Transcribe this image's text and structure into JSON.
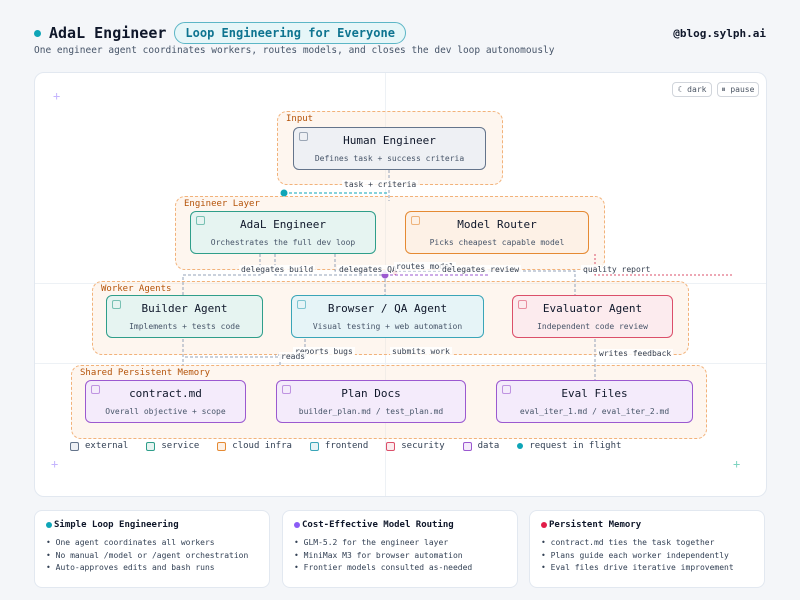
{
  "header": {
    "title": "AdaL Engineer",
    "pill": "Loop Engineering for Everyone",
    "handle": "@blog.sylph.ai",
    "subtitle": "One engineer agent coordinates workers, routes models, and closes the dev loop autonomously"
  },
  "toolbar": {
    "dark_label": "☾ dark",
    "pause_label": "⏸ pause"
  },
  "groups": {
    "input": "Input",
    "engineer": "Engineer Layer",
    "workers": "Worker Agents",
    "memory": "Shared Persistent Memory"
  },
  "nodes": {
    "human": {
      "title": "Human Engineer",
      "sub": "Defines task + success criteria"
    },
    "adal": {
      "title": "AdaL Engineer",
      "sub": "Orchestrates the full dev loop"
    },
    "router": {
      "title": "Model Router",
      "sub": "Picks cheapest capable model"
    },
    "builder": {
      "title": "Builder Agent",
      "sub": "Implements + tests code"
    },
    "browser": {
      "title": "Browser / QA Agent",
      "sub": "Visual testing + web automation"
    },
    "evaluator": {
      "title": "Evaluator Agent",
      "sub": "Independent code review"
    },
    "contract": {
      "title": "contract.md",
      "sub": "Overall objective + scope"
    },
    "plan": {
      "title": "Plan Docs",
      "sub": "builder_plan.md / test_plan.md"
    },
    "eval": {
      "title": "Eval Files",
      "sub": "eval_iter_1.md / eval_iter_2.md"
    }
  },
  "edges": {
    "task": "task + criteria",
    "delegates_build": "delegates build",
    "delegates_qa": "delegates QA",
    "routes_model": "routes model",
    "delegates_review": "delegates review",
    "quality_report": "quality report",
    "reports_bugs": "reports bugs",
    "submits_work": "submits work",
    "writes_feedback": "writes feedback",
    "reads": "reads"
  },
  "legend": [
    "external",
    "service",
    "cloud infra",
    "frontend",
    "security",
    "data",
    "request in flight"
  ],
  "colors": {
    "external": "#64748b",
    "service": "#2f9e8a",
    "cloud_infra": "#e58a33",
    "frontend": "#3aa5b8",
    "security": "#db4f6a",
    "data": "#9b59d0",
    "flight": "#0ea5b7"
  },
  "cards": [
    {
      "title": "Simple Loop Engineering",
      "color": "#0ea5b7",
      "items": [
        "One agent coordinates all workers",
        "No manual /model or /agent orchestration",
        "Auto-approves edits and bash runs"
      ]
    },
    {
      "title": "Cost-Effective Model Routing",
      "color": "#8b5cf6",
      "items": [
        "GLM-5.2 for the engineer layer",
        "MiniMax M3 for browser automation",
        "Frontier models consulted as-needed"
      ]
    },
    {
      "title": "Persistent Memory",
      "color": "#e11d48",
      "items": [
        "contract.md ties the task together",
        "Plans guide each worker independently",
        "Eval files drive iterative improvement"
      ]
    }
  ]
}
